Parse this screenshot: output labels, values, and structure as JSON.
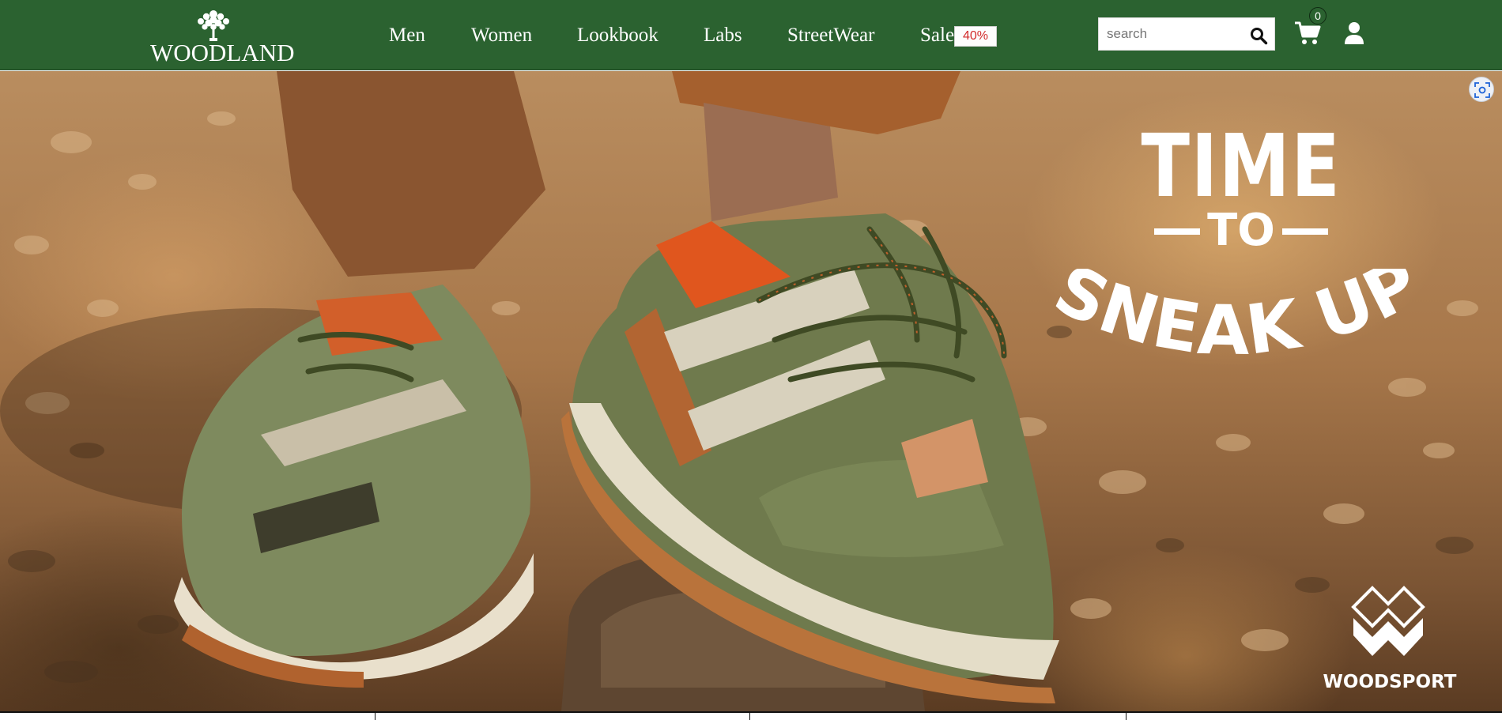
{
  "brand": {
    "logo_text": "WOODLAND",
    "tree_icon": "tree-icon"
  },
  "nav": {
    "links": [
      {
        "label": "Men"
      },
      {
        "label": "Women"
      },
      {
        "label": "Lookbook"
      },
      {
        "label": "Labs"
      },
      {
        "label": "StreetWear"
      },
      {
        "label": "Sale"
      }
    ],
    "sale_badge": "40%"
  },
  "search": {
    "placeholder": "search",
    "value": "",
    "icon": "search-icon"
  },
  "cart": {
    "count": "0",
    "icon": "cart-icon"
  },
  "user": {
    "icon": "user-icon"
  },
  "hero": {
    "headline_line1": "TIME",
    "headline_line2": "TO",
    "headline_line3": "SNEAK UP",
    "brand_name": "WOODSPORT",
    "expand_icon": "scan-icon"
  },
  "colors": {
    "header_bg": "#2b6230",
    "text_light": "#ffffff",
    "sale_red": "#d22a2a"
  }
}
